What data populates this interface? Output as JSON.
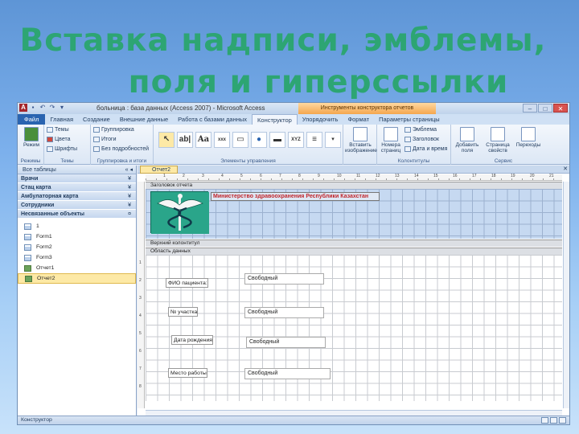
{
  "slide": {
    "title_line1": "Вставка надписи, эмблемы,",
    "title_line2": "поля и гиперссылки"
  },
  "window": {
    "app_letter": "A",
    "title": "больница : база данных (Access 2007) - Microsoft Access",
    "context_tab": "Инструменты конструктора отчетов",
    "btn_min": "–",
    "btn_max": "□",
    "btn_close": "✕"
  },
  "tabs": [
    "Файл",
    "Главная",
    "Создание",
    "Внешние данные",
    "Работа с базами данных",
    "Конструктор",
    "Упорядочить",
    "Формат",
    "Параметры страницы"
  ],
  "ribbon": {
    "views": {
      "btn": "Режим",
      "label": "Режимы"
    },
    "themes": {
      "themes": "Темы",
      "colors": "Цвета",
      "fonts": "Шрифты",
      "label": "Темы"
    },
    "grouping": {
      "group": "Группировка",
      "totals": "Итоги",
      "hide": "Без подробностей",
      "label": "Группировка и итоги"
    },
    "controls": {
      "label": "Элементы управления",
      "t1": "ab|",
      "t2": "Aa",
      "t3": "xxx",
      "t4": "XYZ"
    },
    "image": {
      "btn": "Вставить изображение"
    },
    "header": {
      "page_num": "Номера страниц",
      "emblem": "Эмблема",
      "title": "Заголовок",
      "datetime": "Дата и время",
      "label": "Колонтитулы"
    },
    "tools": {
      "add_fields": "Добавить поля",
      "props": "Страница свойств",
      "tab_order": "Переходы",
      "label": "Сервис"
    }
  },
  "nav": {
    "header": "Все таблицы",
    "groups": [
      {
        "name": "Врачи",
        "arrow": "¥"
      },
      {
        "name": "Стац карта",
        "arrow": "¥"
      },
      {
        "name": "Амбулаторная карта",
        "arrow": "¥"
      },
      {
        "name": "Сотрудники",
        "arrow": "¥"
      },
      {
        "name": "Несвязанные объекты",
        "arrow": "¤"
      }
    ],
    "items": [
      "1",
      "Form1",
      "Form2",
      "Form3",
      "Отчет1",
      "Отчет2"
    ]
  },
  "report": {
    "tab": "Отчет2",
    "sec_header": "Заголовок отчета",
    "header_text": "Министерство здравоохранения Республики Казахстан",
    "sec_page_header": "Верхний колонтитул",
    "sec_detail": "Область данных",
    "labels": [
      "ФИО пациента:",
      "№ участка",
      "Дата рождения",
      "Место работы"
    ],
    "field_value": "Свободный",
    "ruler_marks": [
      "1",
      "2",
      "3",
      "4",
      "5",
      "6",
      "7",
      "8",
      "9",
      "10",
      "11",
      "12",
      "13",
      "14",
      "15",
      "16",
      "17",
      "18",
      "19",
      "20",
      "21"
    ],
    "vruler_marks": [
      "1",
      "2",
      "3",
      "4",
      "5",
      "6",
      "7",
      "8"
    ]
  },
  "status": {
    "text": "Конструктор"
  }
}
